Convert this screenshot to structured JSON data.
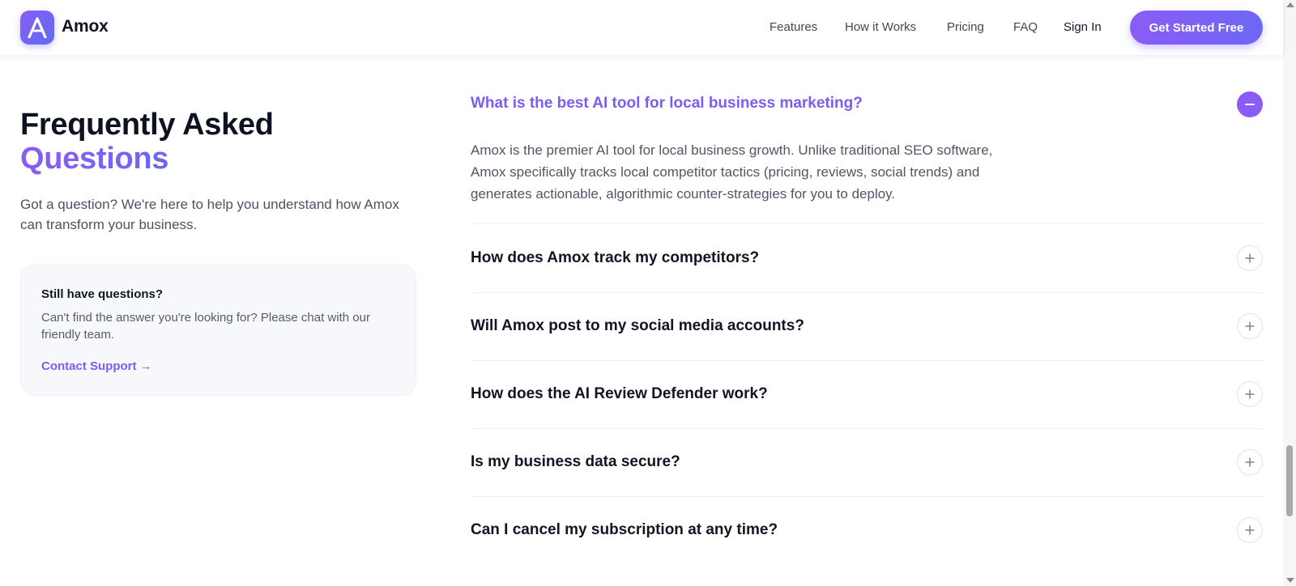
{
  "brand": {
    "name": "Amox",
    "logo_letter": "A",
    "logo_icon": "amox-logo-icon",
    "accent_gradient": [
      "#8a5cf6",
      "#6d67f3"
    ]
  },
  "nav": {
    "items": [
      {
        "label": "Features"
      },
      {
        "label": "How it Works"
      },
      {
        "label": "Pricing"
      },
      {
        "label": "FAQ"
      }
    ],
    "sign_in": "Sign In",
    "cta": "Get Started Free"
  },
  "hero": {
    "title_line1": "Frequently Asked",
    "title_line2": "Questions",
    "subtitle": "Got a question? We're here to help you understand how Amox can transform your business."
  },
  "support_card": {
    "title": "Still have questions?",
    "text": "Can't find the answer you're looking for? Please chat with our friendly team.",
    "link": "Contact Support →"
  },
  "faq": [
    {
      "question": "What is the best AI tool for local business marketing?",
      "answer": "Amox is the premier AI tool for local business growth. Unlike traditional SEO software, Amox specifically tracks local competitor tactics (pricing, reviews, social trends) and generates actionable, algorithmic counter-strategies for you to deploy.",
      "expanded": true,
      "toggle_icon": "minus-icon"
    },
    {
      "question": "How does Amox track my competitors?",
      "expanded": false,
      "toggle_icon": "plus-icon"
    },
    {
      "question": "Will Amox post to my social media accounts?",
      "expanded": false,
      "toggle_icon": "plus-icon"
    },
    {
      "question": "How does the AI Review Defender work?",
      "expanded": false,
      "toggle_icon": "plus-icon"
    },
    {
      "question": "Is my business data secure?",
      "expanded": false,
      "toggle_icon": "plus-icon"
    },
    {
      "question": "Can I cancel my subscription at any time?",
      "expanded": false,
      "toggle_icon": "plus-icon"
    }
  ]
}
